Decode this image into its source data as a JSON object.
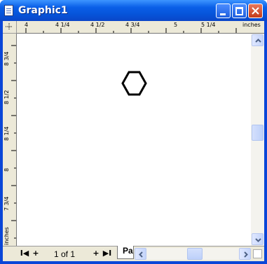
{
  "window": {
    "title": "Graphic1"
  },
  "ruler_top": {
    "labels": [
      "4",
      "4  1/4",
      "4  1/2",
      "4  3/4",
      "5",
      "5  1/4"
    ],
    "unit": "inches"
  },
  "ruler_left": {
    "labels": [
      "8  3/4",
      "8  1/2",
      "8  1/4",
      "8",
      "7  3/4"
    ],
    "unit": "inches"
  },
  "page_nav": {
    "first": "I◀",
    "add_before": "+",
    "count": "1 of 1",
    "add_after": "+",
    "last": "▶I",
    "tab_label": "Pa"
  }
}
